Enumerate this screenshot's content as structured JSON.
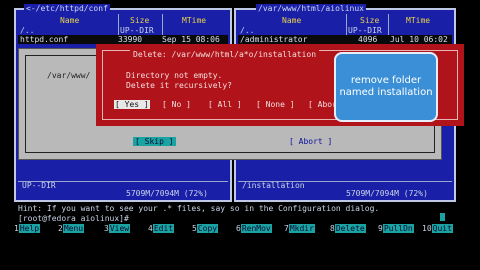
{
  "left_panel": {
    "path": "<-/etc/httpd/conf",
    "cols": [
      "Name",
      "Size",
      "MTime"
    ],
    "rows": [
      {
        "name": "/..",
        "size": "UP--DIR",
        "mtime": "",
        "selected": false
      },
      {
        "name": "httpd.conf",
        "size": "33990",
        "mtime": "Sep 15 08:06",
        "selected": true
      }
    ],
    "status": "UP--DIR",
    "free": "5709M/7094M (72%)"
  },
  "right_panel": {
    "path": "/var/www/html/aiolinux",
    "cols": [
      "Name",
      "Size",
      "MTime"
    ],
    "rows": [
      {
        "name": "/..",
        "size": "UP--DIR",
        "mtime": "",
        "selected": false
      },
      {
        "name": "/administrator",
        "size": "4096",
        "mtime": "Jul 10 06:02",
        "selected": true
      }
    ],
    "status": "/installation",
    "free": "5709M/7094M (72%)"
  },
  "bg_dialog": {
    "path": "/var/www/",
    "skip_label": "[ Skip ]",
    "abort_label": "[ Abort ]"
  },
  "delete_dialog": {
    "title": "Delete: /var/www/html/a*o/installation",
    "line1": "Directory not empty.",
    "line2": "Delete it recursively?",
    "buttons": [
      "[ Yes ]",
      "[ No ]",
      "[ All ]",
      "[ None ]",
      "[ Abort ]"
    ]
  },
  "callout": {
    "text": "remove folder named installation"
  },
  "hint": "Hint: If you want to see your .* files, say so in the Configuration dialog.",
  "prompt": "[root@fedora aiolinux]#",
  "fkeys": [
    {
      "n": "1",
      "label": "Help"
    },
    {
      "n": "2",
      "label": "Menu"
    },
    {
      "n": "3",
      "label": "View"
    },
    {
      "n": "4",
      "label": "Edit"
    },
    {
      "n": "5",
      "label": "Copy"
    },
    {
      "n": "6",
      "label": "RenMov"
    },
    {
      "n": "7",
      "label": "Mkdir"
    },
    {
      "n": "8",
      "label": "Delete"
    },
    {
      "n": "9",
      "label": "PullDn"
    },
    {
      "n": "10",
      "label": "Quit"
    }
  ]
}
